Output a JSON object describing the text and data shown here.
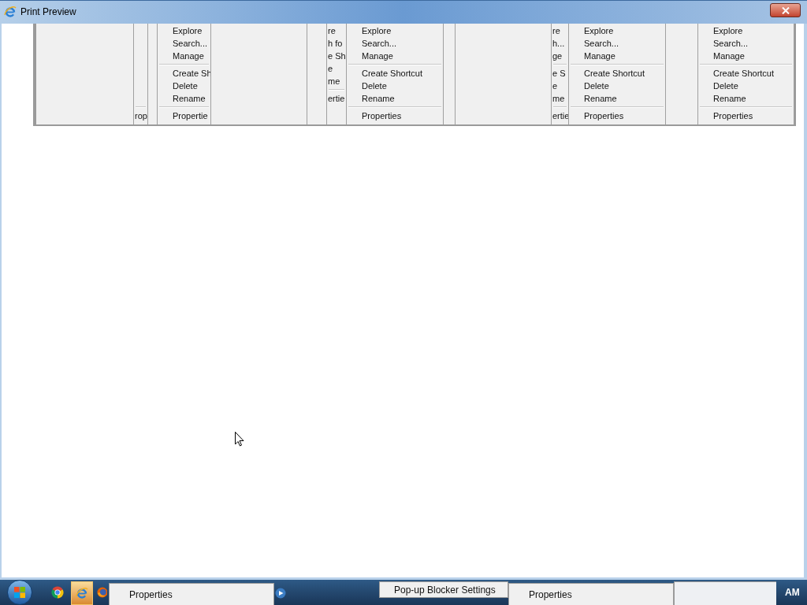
{
  "window": {
    "title": "Print Preview"
  },
  "menu_strip": {
    "panels": [
      {
        "kind": "blank"
      },
      {
        "kind": "stub",
        "items": [
          {
            "kind": "separator"
          },
          {
            "kind": "item",
            "label": "rop"
          }
        ]
      },
      {
        "kind": "blank"
      },
      {
        "kind": "menu",
        "items": [
          {
            "kind": "item",
            "label": "Explore"
          },
          {
            "kind": "item",
            "label": "Search..."
          },
          {
            "kind": "item",
            "label": "Manage"
          },
          {
            "kind": "separator"
          },
          {
            "kind": "item",
            "label": "Create Sh"
          },
          {
            "kind": "item",
            "label": "Delete"
          },
          {
            "kind": "item",
            "label": "Rename"
          },
          {
            "kind": "separator"
          },
          {
            "kind": "item",
            "label": "Propertie"
          }
        ]
      },
      {
        "kind": "blank"
      },
      {
        "kind": "blank"
      },
      {
        "kind": "menu",
        "items": [
          {
            "kind": "item",
            "label": "re"
          },
          {
            "kind": "item",
            "label": "h fo"
          },
          {
            "kind": "item",
            "label": "e Sh"
          },
          {
            "kind": "item",
            "label": "e"
          },
          {
            "kind": "item",
            "label": "me"
          },
          {
            "kind": "separator"
          },
          {
            "kind": "item",
            "label": "ertie"
          }
        ]
      },
      {
        "kind": "menu",
        "items": [
          {
            "kind": "item",
            "label": "Explore"
          },
          {
            "kind": "item",
            "label": "Search..."
          },
          {
            "kind": "item",
            "label": "Manage"
          },
          {
            "kind": "separator"
          },
          {
            "kind": "item",
            "label": "Create Shortcut"
          },
          {
            "kind": "item",
            "label": "Delete"
          },
          {
            "kind": "item",
            "label": "Rename"
          },
          {
            "kind": "separator"
          },
          {
            "kind": "item",
            "label": "Properties"
          }
        ]
      },
      {
        "kind": "blank"
      },
      {
        "kind": "blank"
      },
      {
        "kind": "menu",
        "items": [
          {
            "kind": "item",
            "label": "re"
          },
          {
            "kind": "item",
            "label": "h..."
          },
          {
            "kind": "item",
            "label": "ge"
          },
          {
            "kind": "separator"
          },
          {
            "kind": "item",
            "label": "e S"
          },
          {
            "kind": "item",
            "label": "e"
          },
          {
            "kind": "item",
            "label": "me"
          },
          {
            "kind": "separator"
          },
          {
            "kind": "item",
            "label": "ertie"
          }
        ]
      },
      {
        "kind": "menu",
        "items": [
          {
            "kind": "item",
            "label": "Explore"
          },
          {
            "kind": "item",
            "label": "Search..."
          },
          {
            "kind": "item",
            "label": "Manage"
          },
          {
            "kind": "separator"
          },
          {
            "kind": "item",
            "label": "Create Shortcut"
          },
          {
            "kind": "item",
            "label": "Delete"
          },
          {
            "kind": "item",
            "label": "Rename"
          },
          {
            "kind": "separator"
          },
          {
            "kind": "item",
            "label": "Properties"
          }
        ]
      },
      {
        "kind": "blank"
      },
      {
        "kind": "menu",
        "items": [
          {
            "kind": "item",
            "label": "Explore"
          },
          {
            "kind": "item",
            "label": "Search..."
          },
          {
            "kind": "item",
            "label": "Manage"
          },
          {
            "kind": "separator"
          },
          {
            "kind": "item",
            "label": "Create Shortcut"
          },
          {
            "kind": "item",
            "label": "Delete"
          },
          {
            "kind": "item",
            "label": "Rename"
          },
          {
            "kind": "separator"
          },
          {
            "kind": "item",
            "label": "Properties"
          }
        ]
      }
    ]
  },
  "taskbar": {
    "items": [
      {
        "kind": "start"
      },
      {
        "kind": "chrome",
        "selected": false
      },
      {
        "kind": "ie",
        "selected": true
      },
      {
        "kind": "firefox",
        "selected": false
      },
      {
        "kind": "menu",
        "label": "Properties"
      },
      {
        "kind": "media"
      },
      {
        "kind": "popup",
        "label": "Pop-up Blocker Settings"
      },
      {
        "kind": "menu",
        "label": "Properties"
      },
      {
        "kind": "blank"
      }
    ],
    "clock": "AM"
  }
}
